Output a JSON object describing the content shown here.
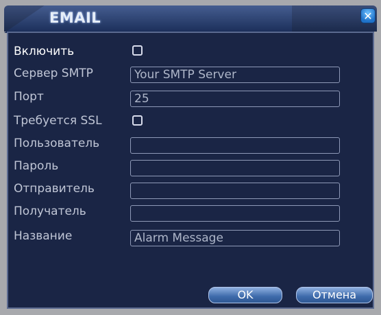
{
  "window": {
    "title": "EMAIL",
    "close_symbol": "✕"
  },
  "form": {
    "enable_label": "Включить",
    "smtp_server_label": "Сервер SMTP",
    "smtp_server_value": "Your SMTP Server",
    "port_label": "Порт",
    "port_value": "25",
    "ssl_label": "Требуется SSL",
    "user_label": "Пользователь",
    "user_value": "",
    "password_label": "Пароль",
    "password_value": "",
    "sender_label": "Отправитель",
    "sender_value": "",
    "receiver_label": "Получатель",
    "receiver_value": "",
    "subject_label": "Название",
    "subject_value": "Alarm Message",
    "enable_checked": false,
    "ssl_checked": false
  },
  "buttons": {
    "ok_label": "OK",
    "cancel_label": "Отмена"
  },
  "colors": {
    "panel_bg": "#1a2545",
    "accent": "#3d6aaa",
    "close_button": "#1f72c9"
  },
  "icons": {
    "close": "close-icon"
  }
}
